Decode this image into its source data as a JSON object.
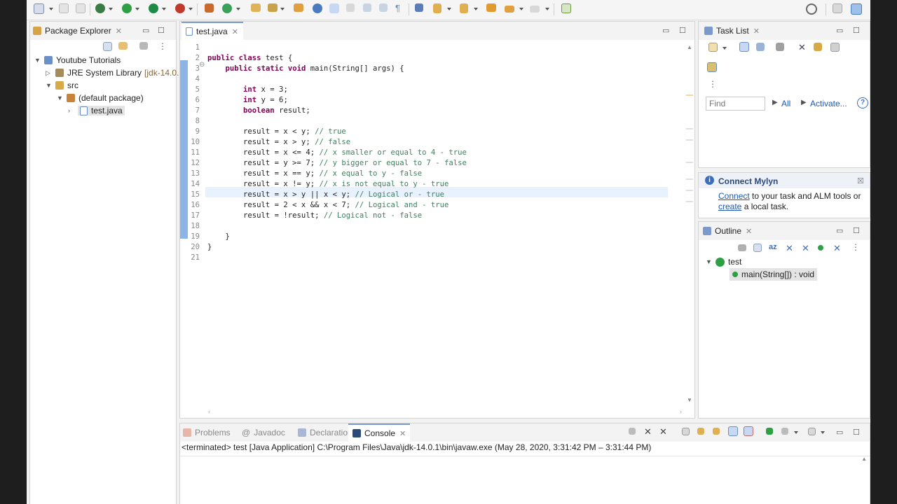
{
  "package_explorer": {
    "title": "Package Explorer",
    "tree": [
      {
        "label": "Youtube Tutorials",
        "level": 0,
        "expanded": true
      },
      {
        "label": "JRE System Library",
        "suffix": "[jdk-14.0.",
        "level": 1,
        "expanded": false
      },
      {
        "label": "src",
        "level": 1,
        "expanded": true
      },
      {
        "label": "(default package)",
        "level": 2,
        "expanded": true
      },
      {
        "label": "test.java",
        "level": 3,
        "expanded": false
      }
    ]
  },
  "editor": {
    "tab_label": "test.java",
    "line_numbers": [
      "1",
      "2",
      "3",
      "4",
      "5",
      "6",
      "7",
      "8",
      "9",
      "10",
      "11",
      "12",
      "13",
      "14",
      "15",
      "16",
      "17",
      "18",
      "19",
      "20",
      "21"
    ],
    "fold_marker": "⊖",
    "lines": [
      "",
      "public class test {",
      "    public static void main(String[] args) {",
      "",
      "        int x = 3;",
      "        int y = 6;",
      "        boolean result;",
      "",
      "        result = x < y; // true",
      "        result = x > y; // false",
      "        result = x <= 4; // x smaller or equal to 4 - true",
      "        result = y >= 7; // y bigger or equal to 7 - false",
      "        result = x == y; // x equal to y - false",
      "        result = x != y; // x is not equal to y - true",
      "        result = x > y || x < y; // Logical or - true",
      "        result = 2 < x && x < 7; // Logical and - true",
      "        result = !result; // Logical not - false",
      "",
      "    }",
      "}",
      ""
    ]
  },
  "task_list": {
    "title": "Task List",
    "find_placeholder": "Find",
    "all_label": "All",
    "activate_label": "Activate...",
    "help": "?"
  },
  "mylyn": {
    "title": "Connect Mylyn",
    "connect_link": "Connect",
    "text1": " to your task and ALM tools or",
    "create_link": "create",
    "text2": " a local task."
  },
  "outline": {
    "title": "Outline",
    "class_name": "test",
    "method_name": "main(String[]) : void"
  },
  "bottom_tabs": {
    "problems": "Problems",
    "javadoc": "Javadoc",
    "declaration": "Declaration",
    "console": "Console"
  },
  "console": {
    "status": "<terminated> test [Java Application] C:\\Program Files\\Java\\jdk-14.0.1\\bin\\javaw.exe  (May 28, 2020, 3:31:42 PM – 3:31:44 PM)"
  },
  "colors": {
    "keyword": "#7f0055",
    "comment": "#3f7f5f",
    "link": "#1a57b5",
    "active_tab_border": "#7a9cd3"
  }
}
